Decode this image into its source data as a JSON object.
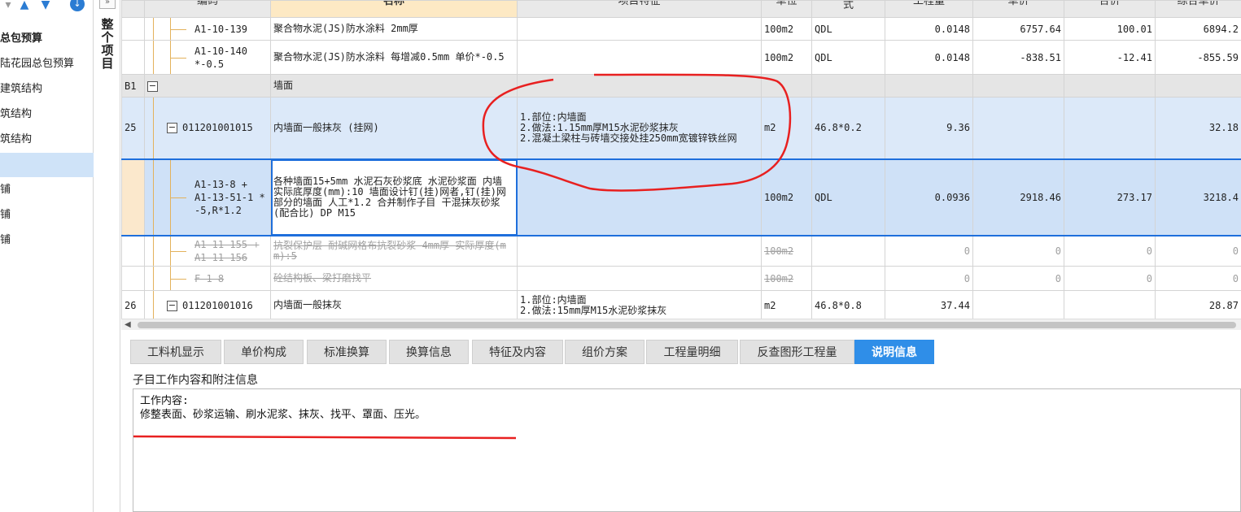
{
  "sidebar": {
    "toolbar_icons": [
      "arrow-up-icon",
      "arrow-down-icon",
      "download-circle-icon"
    ],
    "items": [
      {
        "label": "总包预算",
        "bold": true,
        "selected": false
      },
      {
        "label": "陆花园总包预算",
        "bold": false,
        "selected": false
      },
      {
        "label": "建筑结构",
        "bold": false,
        "selected": false
      },
      {
        "label": "筑结构",
        "bold": false,
        "selected": false
      },
      {
        "label": "筑结构",
        "bold": false,
        "selected": false
      },
      {
        "label": "",
        "bold": false,
        "selected": true
      },
      {
        "label": "铺",
        "bold": false,
        "selected": false
      },
      {
        "label": "铺",
        "bold": false,
        "selected": false
      },
      {
        "label": "铺",
        "bold": false,
        "selected": false
      }
    ]
  },
  "mid": {
    "collapse_label": "»",
    "vertical_label": [
      "整",
      "个",
      "项",
      "目"
    ]
  },
  "grid": {
    "headers": [
      "编码",
      "名称",
      "项目特征",
      "单位",
      "式",
      "工程量",
      "单价",
      "合价",
      "综合单价"
    ],
    "rows": [
      {
        "num": "",
        "code": "A1-10-139",
        "name": "聚合物水泥(JS)防水涂料 2mm厚",
        "feature": "",
        "unit": "100m2",
        "formula": "QDL",
        "qty": "0.0148",
        "price": "6757.64",
        "total": "100.01",
        "unitprice": "6894.2"
      },
      {
        "num": "",
        "code": "A1-10-140 *-0.5",
        "name": "聚合物水泥(JS)防水涂料 每增减0.5mm 单价*-0.5",
        "feature": "",
        "unit": "100m2",
        "formula": "QDL",
        "qty": "0.0148",
        "price": "-838.51",
        "total": "-12.41",
        "unitprice": "-855.59"
      },
      {
        "num": "B1",
        "code": "",
        "name": "墙面",
        "feature": "",
        "unit": "",
        "formula": "",
        "qty": "",
        "price": "",
        "total": "",
        "unitprice": ""
      },
      {
        "num": "25",
        "code": "011201001015",
        "name": "内墙面一般抹灰 (挂网)",
        "feature": "1.部位:内墙面\n2.做法:1.15mm厚M15水泥砂浆抹灰\n2.混凝土梁柱与砖墙交接处挂250mm宽镀锌铁丝网",
        "unit": "m2",
        "formula": "46.8*0.2",
        "qty": "9.36",
        "price": "",
        "total": "",
        "unitprice": "32.18"
      },
      {
        "num": "",
        "code": "A1-13-8 + A1-13-51-1 * -5,R*1.2",
        "name": "各种墙面15+5mm 水泥石灰砂浆底 水泥砂浆面 内墙 实际底厚度(mm):10 墙面设计钉(挂)网者,钉(挂)网部分的墙面 人工*1.2 合并制作子目 干混抹灰砂浆(配合比) DP M15",
        "feature": "",
        "unit": "100m2",
        "formula": "QDL",
        "qty": "0.0936",
        "price": "2918.46",
        "total": "273.17",
        "unitprice": "3218.4"
      },
      {
        "num": "",
        "code": "A1-11-155 + A1-11-156",
        "name": "抗裂保护层 耐碱网格布抗裂砂浆 4mm厚 实际厚度(mm):5",
        "feature": "",
        "unit": "100m2",
        "formula": "",
        "qty": "0",
        "price": "0",
        "total": "0",
        "unitprice": "0"
      },
      {
        "num": "",
        "code": "F-1-8",
        "name": "砼结构板、梁打磨找平",
        "feature": "",
        "unit": "100m2",
        "formula": "",
        "qty": "0",
        "price": "0",
        "total": "0",
        "unitprice": "0"
      },
      {
        "num": "26",
        "code": "011201001016",
        "name": "内墙面一般抹灰",
        "feature": "1.部位:内墙面\n2.做法:15mm厚M15水泥砂浆抹灰",
        "unit": "m2",
        "formula": "46.8*0.8",
        "qty": "37.44",
        "price": "",
        "total": "",
        "unitprice": "28.87"
      }
    ]
  },
  "tabs": [
    {
      "label": "工料机显示",
      "active": false
    },
    {
      "label": "单价构成",
      "active": false
    },
    {
      "label": "标准换算",
      "active": false
    },
    {
      "label": "换算信息",
      "active": false
    },
    {
      "label": "特征及内容",
      "active": false
    },
    {
      "label": "组价方案",
      "active": false
    },
    {
      "label": "工程量明细",
      "active": false
    },
    {
      "label": "反查图形工程量",
      "active": false
    },
    {
      "label": "说明信息",
      "active": true
    }
  ],
  "bottom": {
    "title": "子目工作内容和附注信息",
    "content_line1": "工作内容:",
    "content_line2": "修整表面、砂浆运输、刷水泥浆、抹灰、找平、罩面、压光。"
  },
  "colors": {
    "accent": "#2f8ee8",
    "selection_border": "#1e6fdc",
    "annotation_red": "#e82020",
    "header_highlight": "#fde9c4",
    "tree_line": "#e3b25c"
  }
}
